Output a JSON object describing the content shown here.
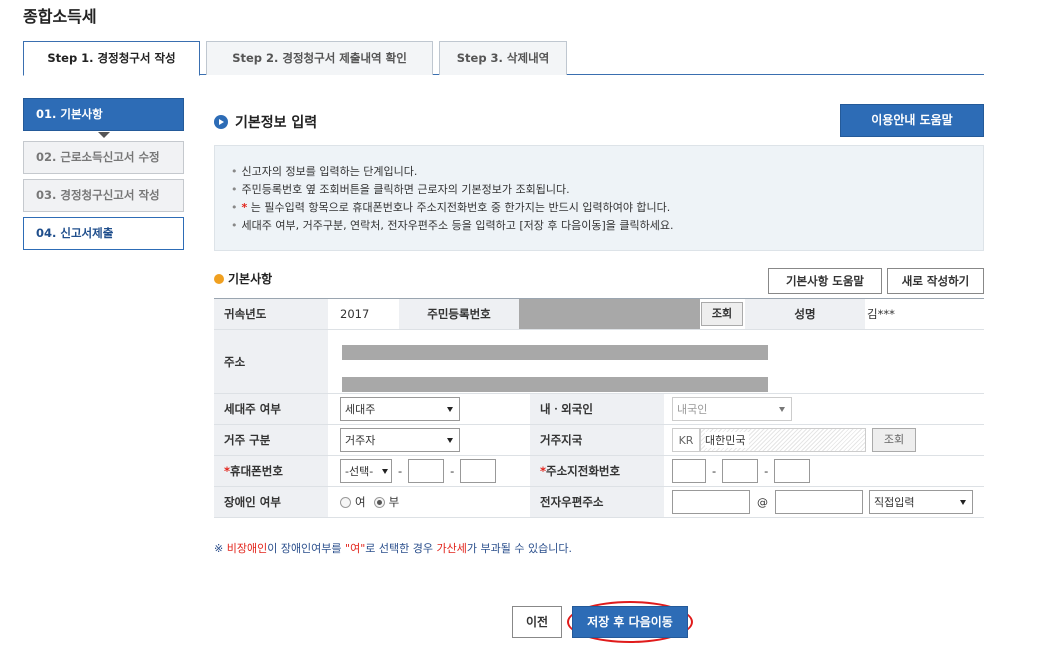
{
  "page": {
    "title": "종합소득세"
  },
  "tabs": [
    {
      "label": "Step 1. 경정청구서 작성"
    },
    {
      "label": "Step 2. 경정청구서 제출내역 확인"
    },
    {
      "label": "Step 3. 삭제내역"
    }
  ],
  "steps": [
    {
      "label": "01. 기본사항"
    },
    {
      "label": "02. 근로소득신고서 수정"
    },
    {
      "label": "03. 경정청구신고서 작성"
    },
    {
      "label": "04. 신고서제출"
    }
  ],
  "section": {
    "title": "기본정보 입력",
    "help_button": "이용안내 도움말",
    "info": [
      "신고자의 정보를 입력하는 단계입니다.",
      "주민등록번호 옆 조회버튼을 클릭하면 근로자의 기본정보가 조회됩니다.",
      "는 필수입력 항목으로 휴대폰번호나 주소지전화번호 중 한가지는 반드시 입력하여야 합니다.",
      "세대주 여부, 거주구분, 연락처, 전자우편주소 등을 입력하고 [저장 후 다음이동]을 클릭하세요."
    ],
    "info_bullet": "•",
    "info_star": "*"
  },
  "basic": {
    "title": "기본사항",
    "help_button": "기본사항 도움말",
    "new_button": "새로 작성하기"
  },
  "form": {
    "year_label": "귀속년도",
    "year_value": "2017",
    "rrn_label": "주민등록번호",
    "lookup_button": "조회",
    "name_label": "성명",
    "name_value": "김***",
    "address_label": "주소",
    "household_label": "세대주 여부",
    "household_value": "세대주",
    "nationality_label": "내ㆍ외국인",
    "nationality_value": "내국인",
    "residence_label": "거주 구분",
    "residence_value": "거주자",
    "country_label": "거주지국",
    "country_code": "KR",
    "country_name": "대한민국",
    "country_lookup_button": "조회",
    "required_mark": "*",
    "mobile_label": "휴대폰번호",
    "mobile_select": "-선택-",
    "phone_label": "주소지전화번호",
    "dash": "-",
    "disabled_label": "장애인 여부",
    "disabled_yes": "여",
    "disabled_no": "부",
    "email_label": "전자우편주소",
    "email_at": "@",
    "email_domain": "직접입력"
  },
  "notice": {
    "prefix": "※ ",
    "red1": "비장애인",
    "mid1": "이 장애인여부를 ",
    "red2": "\"여\"",
    "mid2": "로 선택한 경우 ",
    "red3": "가산세",
    "suffix": "가 부과될 수 있습니다."
  },
  "buttons": {
    "prev": "이전",
    "save_next": "저장 후 다음이동"
  },
  "colors": {
    "primary": "#2d6cb6",
    "required": "#e2231a",
    "highlight_circle": "#e01b1b"
  }
}
